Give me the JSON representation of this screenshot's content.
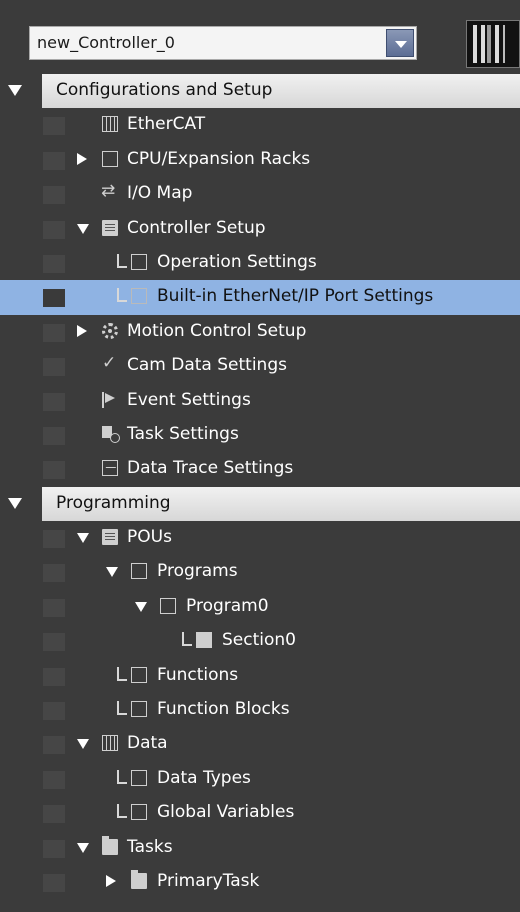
{
  "controller_select": {
    "value": "new_Controller_0"
  },
  "sections": {
    "config": {
      "label": "Configurations and Setup"
    },
    "programming": {
      "label": "Programming"
    }
  },
  "items": {
    "ethercat": {
      "label": "EtherCAT"
    },
    "cpu_racks": {
      "label": "CPU/Expansion Racks"
    },
    "io_map": {
      "label": "I/O Map"
    },
    "controller_setup": {
      "label": "Controller Setup"
    },
    "operation_settings": {
      "label": "Operation Settings"
    },
    "ethernet_port": {
      "label": "Built-in EtherNet/IP Port Settings"
    },
    "motion_setup": {
      "label": "Motion Control Setup"
    },
    "cam_data": {
      "label": "Cam Data Settings"
    },
    "event_settings": {
      "label": "Event Settings"
    },
    "task_settings": {
      "label": "Task Settings"
    },
    "data_trace": {
      "label": "Data Trace Settings"
    },
    "pous": {
      "label": "POUs"
    },
    "programs": {
      "label": "Programs"
    },
    "program0": {
      "label": "Program0"
    },
    "section0": {
      "label": "Section0"
    },
    "functions": {
      "label": "Functions"
    },
    "function_blocks": {
      "label": "Function Blocks"
    },
    "data": {
      "label": "Data"
    },
    "data_types": {
      "label": "Data Types"
    },
    "global_variables": {
      "label": "Global Variables"
    },
    "tasks": {
      "label": "Tasks"
    },
    "primary_task": {
      "label": "PrimaryTask"
    }
  },
  "colors": {
    "background": "#3b3b3b",
    "selection": "#8fb3e3",
    "header": "#e4e4e4"
  }
}
